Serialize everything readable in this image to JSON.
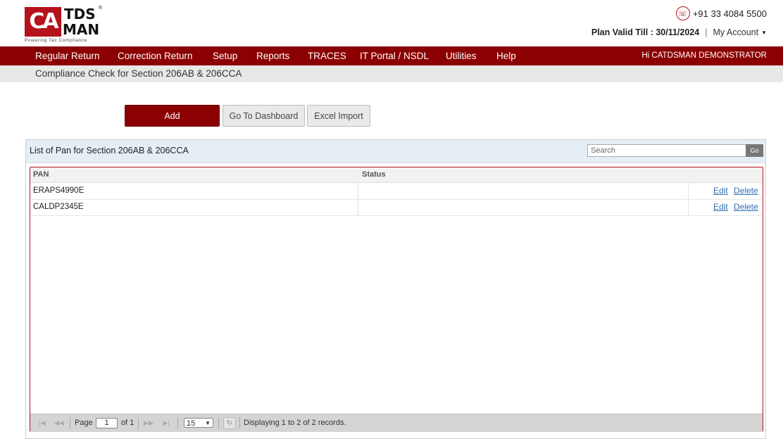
{
  "brand": {
    "logo_mark": "CA",
    "logo_line1": "TDS",
    "logo_line2": "MAN",
    "logo_reg": "®",
    "tagline": "Powering Tax Compliance"
  },
  "header": {
    "phone": "+91 33 4084 5500",
    "plan_label": "Plan Valid Till : 30/11/2024",
    "separator": "|",
    "account_label": "My Account"
  },
  "menu": {
    "items": [
      "Regular Return",
      "Correction Return",
      "Setup",
      "Reports",
      "TRACES",
      "IT Portal / NSDL",
      "Utilities",
      "Help"
    ],
    "greeting": "Hi CATDSMAN DEMONSTRATOR"
  },
  "breadcrumb": "Compliance Check for Section 206AB & 206CCA",
  "actions": {
    "add": "Add",
    "dashboard": "Go To Dashboard",
    "excel": "Excel Import"
  },
  "panel": {
    "title": "List of Pan for Section 206AB & 206CCA",
    "search_placeholder": "Search",
    "go_label": "Go"
  },
  "table": {
    "columns": [
      "PAN",
      "Status"
    ],
    "rows": [
      {
        "pan": "ERAPS4990E",
        "status": "",
        "edit": "Edit",
        "delete": "Delete"
      },
      {
        "pan": "CALDP2345E",
        "status": "",
        "edit": "Edit",
        "delete": "Delete"
      }
    ]
  },
  "pager": {
    "page_label": "Page",
    "page_value": "1",
    "of_label": "of 1",
    "page_size": "15",
    "display_text": "Displaying 1 to 2 of 2 records."
  },
  "colors": {
    "brand_red": "#8b0000",
    "logo_red": "#b5121b",
    "link_blue": "#2a6fb0"
  }
}
